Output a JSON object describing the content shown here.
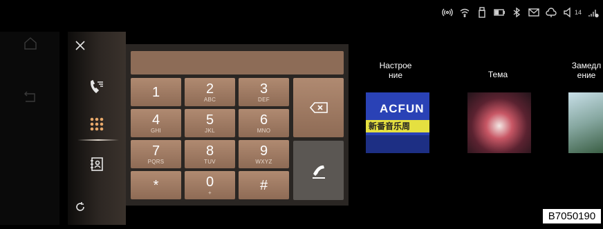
{
  "status_bar": {
    "icons": [
      "hotspot-icon",
      "wifi-icon",
      "usb-icon",
      "battery-icon",
      "bluetooth-icon",
      "mail-icon",
      "cloud-icon",
      "volume-icon",
      "signal-icon"
    ],
    "volume_level": "14"
  },
  "background_rail": {
    "icons": [
      "home-icon",
      "back-icon"
    ]
  },
  "dial_sidebar": {
    "close": "close-icon",
    "items": [
      {
        "icon": "call-log-icon"
      },
      {
        "icon": "keypad-icon",
        "active": true
      },
      {
        "icon": "contacts-icon"
      }
    ],
    "refresh": "refresh-icon"
  },
  "keypad": {
    "display_value": "",
    "keys": [
      {
        "digit": "1",
        "letters": ""
      },
      {
        "digit": "2",
        "letters": "ABC"
      },
      {
        "digit": "3",
        "letters": "DEF"
      },
      {
        "digit": "4",
        "letters": "GHI"
      },
      {
        "digit": "5",
        "letters": "JKL"
      },
      {
        "digit": "6",
        "letters": "MNO"
      },
      {
        "digit": "7",
        "letters": "PQRS"
      },
      {
        "digit": "8",
        "letters": "TUV"
      },
      {
        "digit": "9",
        "letters": "WXYZ"
      },
      {
        "digit": "*",
        "letters": ""
      },
      {
        "digit": "0",
        "letters": "+"
      },
      {
        "digit": "#",
        "letters": ""
      }
    ],
    "backspace": "backspace-icon",
    "call": "phone-icon"
  },
  "tiles": [
    {
      "label": "Настрое\nние"
    },
    {
      "label": "Тема"
    },
    {
      "label": "Замедл\nение"
    }
  ],
  "thumb_acfun": {
    "logo": "ACFUN",
    "banner": "新番音乐周"
  },
  "code_label": "B7050190"
}
